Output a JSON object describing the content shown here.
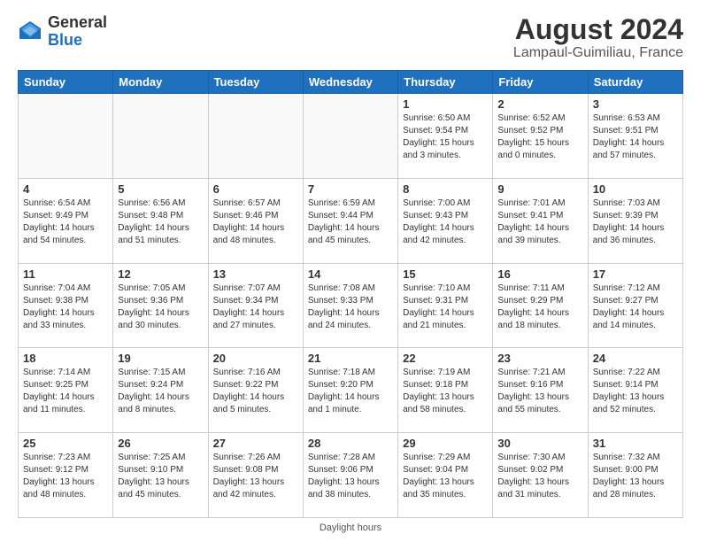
{
  "logo": {
    "general": "General",
    "blue": "Blue"
  },
  "title": "August 2024",
  "subtitle": "Lampaul-Guimiliau, France",
  "days_of_week": [
    "Sunday",
    "Monday",
    "Tuesday",
    "Wednesday",
    "Thursday",
    "Friday",
    "Saturday"
  ],
  "footer": "Daylight hours",
  "weeks": [
    [
      {
        "day": "",
        "info": ""
      },
      {
        "day": "",
        "info": ""
      },
      {
        "day": "",
        "info": ""
      },
      {
        "day": "",
        "info": ""
      },
      {
        "day": "1",
        "info": "Sunrise: 6:50 AM\nSunset: 9:54 PM\nDaylight: 15 hours\nand 3 minutes."
      },
      {
        "day": "2",
        "info": "Sunrise: 6:52 AM\nSunset: 9:52 PM\nDaylight: 15 hours\nand 0 minutes."
      },
      {
        "day": "3",
        "info": "Sunrise: 6:53 AM\nSunset: 9:51 PM\nDaylight: 14 hours\nand 57 minutes."
      }
    ],
    [
      {
        "day": "4",
        "info": "Sunrise: 6:54 AM\nSunset: 9:49 PM\nDaylight: 14 hours\nand 54 minutes."
      },
      {
        "day": "5",
        "info": "Sunrise: 6:56 AM\nSunset: 9:48 PM\nDaylight: 14 hours\nand 51 minutes."
      },
      {
        "day": "6",
        "info": "Sunrise: 6:57 AM\nSunset: 9:46 PM\nDaylight: 14 hours\nand 48 minutes."
      },
      {
        "day": "7",
        "info": "Sunrise: 6:59 AM\nSunset: 9:44 PM\nDaylight: 14 hours\nand 45 minutes."
      },
      {
        "day": "8",
        "info": "Sunrise: 7:00 AM\nSunset: 9:43 PM\nDaylight: 14 hours\nand 42 minutes."
      },
      {
        "day": "9",
        "info": "Sunrise: 7:01 AM\nSunset: 9:41 PM\nDaylight: 14 hours\nand 39 minutes."
      },
      {
        "day": "10",
        "info": "Sunrise: 7:03 AM\nSunset: 9:39 PM\nDaylight: 14 hours\nand 36 minutes."
      }
    ],
    [
      {
        "day": "11",
        "info": "Sunrise: 7:04 AM\nSunset: 9:38 PM\nDaylight: 14 hours\nand 33 minutes."
      },
      {
        "day": "12",
        "info": "Sunrise: 7:05 AM\nSunset: 9:36 PM\nDaylight: 14 hours\nand 30 minutes."
      },
      {
        "day": "13",
        "info": "Sunrise: 7:07 AM\nSunset: 9:34 PM\nDaylight: 14 hours\nand 27 minutes."
      },
      {
        "day": "14",
        "info": "Sunrise: 7:08 AM\nSunset: 9:33 PM\nDaylight: 14 hours\nand 24 minutes."
      },
      {
        "day": "15",
        "info": "Sunrise: 7:10 AM\nSunset: 9:31 PM\nDaylight: 14 hours\nand 21 minutes."
      },
      {
        "day": "16",
        "info": "Sunrise: 7:11 AM\nSunset: 9:29 PM\nDaylight: 14 hours\nand 18 minutes."
      },
      {
        "day": "17",
        "info": "Sunrise: 7:12 AM\nSunset: 9:27 PM\nDaylight: 14 hours\nand 14 minutes."
      }
    ],
    [
      {
        "day": "18",
        "info": "Sunrise: 7:14 AM\nSunset: 9:25 PM\nDaylight: 14 hours\nand 11 minutes."
      },
      {
        "day": "19",
        "info": "Sunrise: 7:15 AM\nSunset: 9:24 PM\nDaylight: 14 hours\nand 8 minutes."
      },
      {
        "day": "20",
        "info": "Sunrise: 7:16 AM\nSunset: 9:22 PM\nDaylight: 14 hours\nand 5 minutes."
      },
      {
        "day": "21",
        "info": "Sunrise: 7:18 AM\nSunset: 9:20 PM\nDaylight: 14 hours\nand 1 minute."
      },
      {
        "day": "22",
        "info": "Sunrise: 7:19 AM\nSunset: 9:18 PM\nDaylight: 13 hours\nand 58 minutes."
      },
      {
        "day": "23",
        "info": "Sunrise: 7:21 AM\nSunset: 9:16 PM\nDaylight: 13 hours\nand 55 minutes."
      },
      {
        "day": "24",
        "info": "Sunrise: 7:22 AM\nSunset: 9:14 PM\nDaylight: 13 hours\nand 52 minutes."
      }
    ],
    [
      {
        "day": "25",
        "info": "Sunrise: 7:23 AM\nSunset: 9:12 PM\nDaylight: 13 hours\nand 48 minutes."
      },
      {
        "day": "26",
        "info": "Sunrise: 7:25 AM\nSunset: 9:10 PM\nDaylight: 13 hours\nand 45 minutes."
      },
      {
        "day": "27",
        "info": "Sunrise: 7:26 AM\nSunset: 9:08 PM\nDaylight: 13 hours\nand 42 minutes."
      },
      {
        "day": "28",
        "info": "Sunrise: 7:28 AM\nSunset: 9:06 PM\nDaylight: 13 hours\nand 38 minutes."
      },
      {
        "day": "29",
        "info": "Sunrise: 7:29 AM\nSunset: 9:04 PM\nDaylight: 13 hours\nand 35 minutes."
      },
      {
        "day": "30",
        "info": "Sunrise: 7:30 AM\nSunset: 9:02 PM\nDaylight: 13 hours\nand 31 minutes."
      },
      {
        "day": "31",
        "info": "Sunrise: 7:32 AM\nSunset: 9:00 PM\nDaylight: 13 hours\nand 28 minutes."
      }
    ]
  ]
}
